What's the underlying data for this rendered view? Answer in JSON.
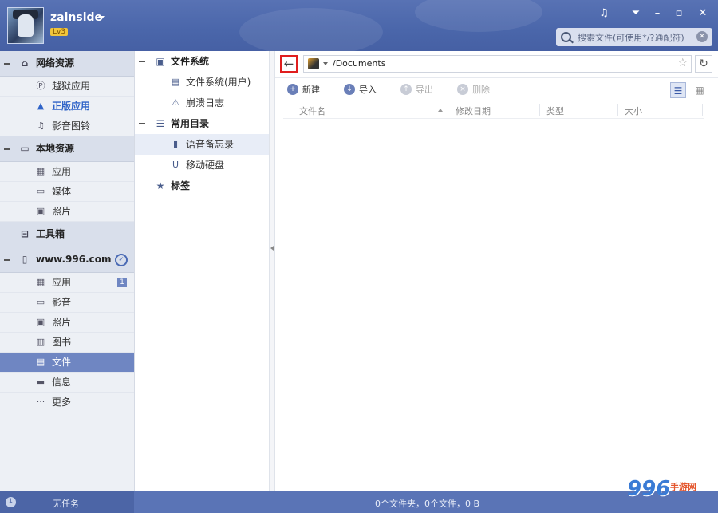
{
  "header": {
    "username": "zainside",
    "level": "Lv3",
    "search_placeholder": "搜索文件(可使用*/?通配符)",
    "window_buttons": [
      "music-icon",
      "menu-icon",
      "minimize-icon",
      "maximize-icon",
      "close-icon"
    ]
  },
  "sidebar": {
    "groups": [
      {
        "label": "网络资源",
        "icon": "home-icon",
        "items": [
          {
            "label": "越狱应用",
            "icon": "p-icon"
          },
          {
            "label": "正版应用",
            "icon": "thumb-icon"
          },
          {
            "label": "影音图铃",
            "icon": "music-icon"
          }
        ]
      },
      {
        "label": "本地资源",
        "icon": "monitor-icon",
        "items": [
          {
            "label": "应用",
            "icon": "grid-icon"
          },
          {
            "label": "媒体",
            "icon": "video-icon"
          },
          {
            "label": "照片",
            "icon": "photo-icon"
          }
        ]
      },
      {
        "label": "工具箱",
        "icon": "toolbox-icon",
        "items": []
      },
      {
        "label": "www.996.com",
        "icon": "phone-icon",
        "items": [
          {
            "label": "应用",
            "icon": "grid-icon",
            "badge": "1"
          },
          {
            "label": "影音",
            "icon": "video-icon"
          },
          {
            "label": "照片",
            "icon": "photo-icon"
          },
          {
            "label": "图书",
            "icon": "book-icon"
          },
          {
            "label": "文件",
            "icon": "file-icon"
          },
          {
            "label": "信息",
            "icon": "message-icon"
          },
          {
            "label": "更多",
            "icon": "more-icon"
          }
        ]
      }
    ]
  },
  "tree": {
    "filesystem_label": "文件系统",
    "filesystem_items": [
      "文件系统(用户)",
      "崩溃日志"
    ],
    "common_label": "常用目录",
    "common_items": [
      "语音备忘录",
      "移动硬盘"
    ],
    "bookmarks_label": "标签"
  },
  "main": {
    "path": "/Documents",
    "toolbar": {
      "new_label": "新建",
      "import_label": "导入",
      "export_label": "导出",
      "delete_label": "删除"
    },
    "columns": [
      "文件名",
      "修改日期",
      "类型",
      "大小"
    ]
  },
  "status": {
    "tasks_label": "无任务",
    "summary": "0个文件夹，0个文件，0 B"
  },
  "watermark": {
    "digits": "996",
    "text": "手游网"
  }
}
